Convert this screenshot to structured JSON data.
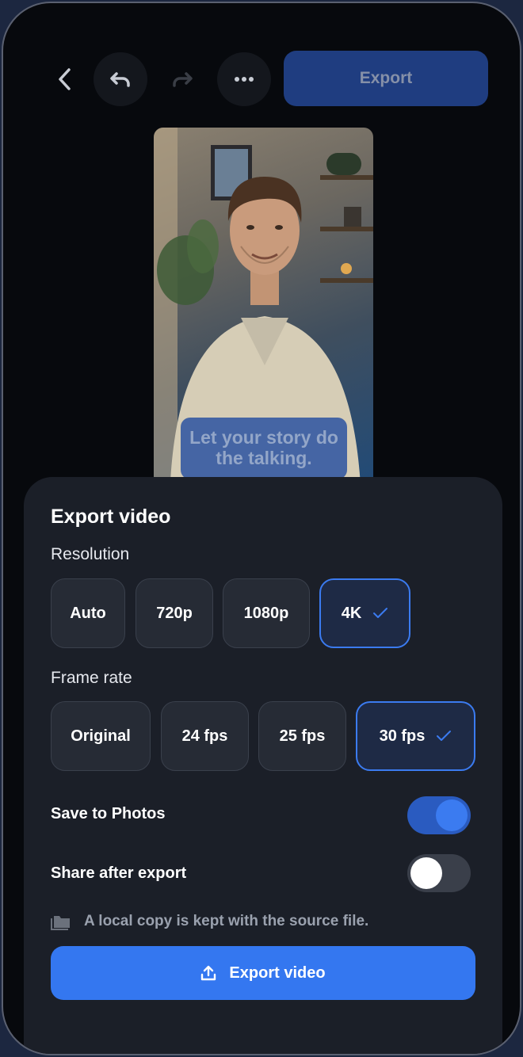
{
  "toolbar": {
    "back_icon": "chevron-left-icon",
    "undo_icon": "undo-icon",
    "redo_icon": "redo-icon",
    "more_icon": "more-icon",
    "export_label": "Export"
  },
  "preview": {
    "caption": "Let your story do the talking."
  },
  "sheet": {
    "title": "Export video",
    "resolution": {
      "label": "Resolution",
      "options": [
        "Auto",
        "720p",
        "1080p",
        "4K"
      ],
      "selected": "4K"
    },
    "frame_rate": {
      "label": "Frame rate",
      "options": [
        "Original",
        "24 fps",
        "25 fps",
        "30 fps"
      ],
      "selected": "30 fps"
    },
    "save_to_photos": {
      "label": "Save to Photos",
      "on": true
    },
    "share_after_export": {
      "label": "Share after export",
      "on": false
    },
    "note": "A local copy is kept with the source file.",
    "export_button": "Export video"
  },
  "colors": {
    "accent": "#3477f0",
    "sheet_bg": "#1b1f28",
    "chip_bg": "#262b35"
  }
}
